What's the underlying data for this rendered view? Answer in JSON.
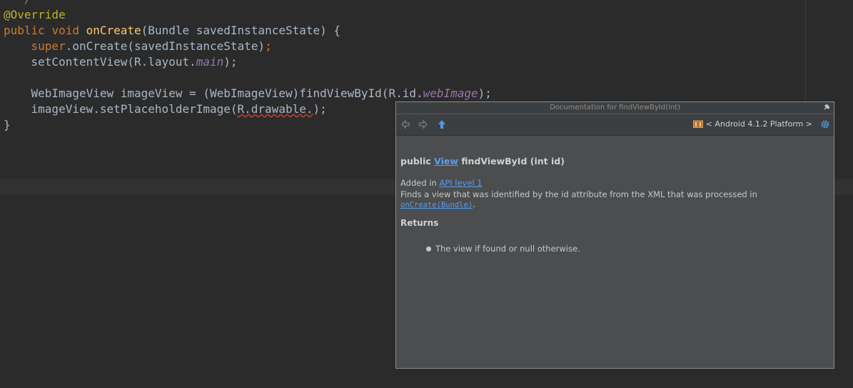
{
  "editor": {
    "lines": {
      "l0": "  */",
      "annotation": "@Override",
      "sig_public": "public",
      "sig_void": "void",
      "sig_name": "onCreate",
      "sig_rest": "(Bundle savedInstanceState) {",
      "l2_super": "super",
      "l2_rest": ".onCreate(savedInstanceState)",
      "l2_semi": ";",
      "l3_call": "setContentView(R.layout.",
      "l3_field": "main",
      "l3_end": ");",
      "l5_start": "WebImageView imageView = (WebImageView)findViewById(R.id.",
      "l5_field": "webImage",
      "l5_end": ");",
      "l6_start": "imageView.setPlaceholderImage(",
      "l6_err": "R.drawable.",
      "l6_end": ");",
      "close_brace": "}"
    }
  },
  "popup": {
    "title": "Documentation for findViewById(int)",
    "platform_label": "< Android 4.1.2 Platform >",
    "signature": {
      "prefix": "public ",
      "type_link": "View",
      "rest": " findViewById (int id)"
    },
    "added_prefix": "Added in ",
    "api_link": "API level 1",
    "description": "Finds a view that was identified by the id attribute from the XML that was processed in ",
    "desc_link": "onCreate(Bundle)",
    "desc_end": ".",
    "returns_heading": "Returns",
    "return_item": "The view if found or null otherwise."
  },
  "colors": {
    "editor_bg": "#2b2b2b",
    "keyword": "#cc7832",
    "function": "#ffc66d",
    "annotation": "#bbb529",
    "field": "#9876aa",
    "link": "#589df6"
  }
}
